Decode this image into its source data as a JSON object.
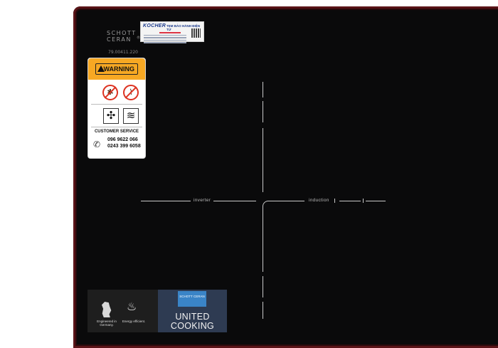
{
  "cooktop": {
    "brand": "SCHOTT CERAN",
    "serial": "79.00411.220",
    "zone_left": "inverter",
    "zone_right": "induction"
  },
  "kocher_sticker": {
    "brand": "KOCHER",
    "title": "TEM BẢO HÀNH ĐIỆN TỬ"
  },
  "warning_card": {
    "title": "WARNING",
    "icons": [
      "no-cockroach-icon",
      "no-scratch-icon",
      "fan-icon",
      "heat-waves-icon"
    ],
    "service_label": "CUSTOMER SERVICE",
    "phones": [
      "096 9622 066",
      "0243 399 6058"
    ]
  },
  "banner": {
    "engineered": "Engineered in Germany.",
    "energy": "Energy efficient.",
    "logo": "SCHOTT CERAN",
    "title_line1": "UNITED",
    "title_line2": "COOKING"
  },
  "colors": {
    "glass": "#0a0a0b",
    "frame": "#5a1418",
    "warning_orange": "#f7a823",
    "banner_blue": "#2e3b52"
  }
}
